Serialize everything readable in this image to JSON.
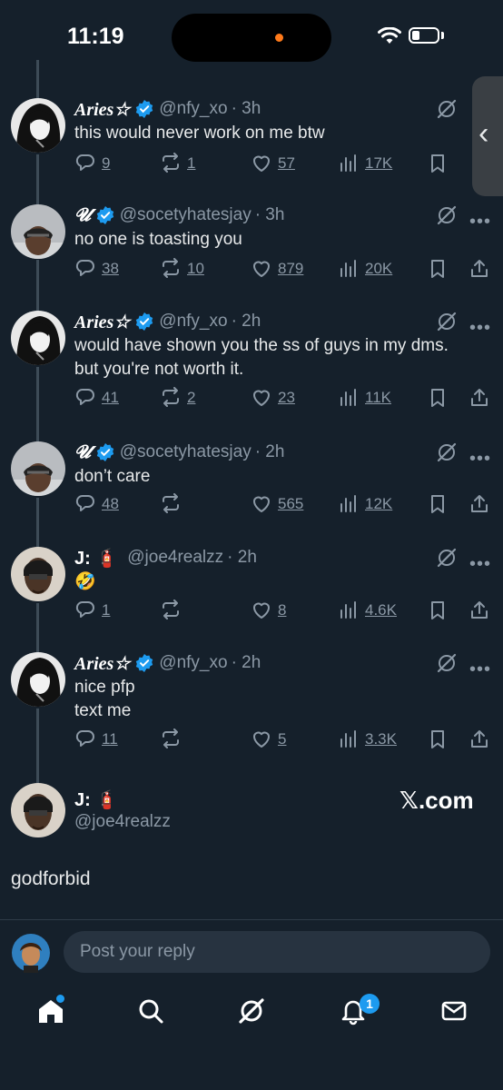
{
  "status_bar": {
    "time": "11:19"
  },
  "tweets": [
    {
      "name": "Aries☆",
      "handle": "@nfy_xo",
      "time": "· 3h",
      "text": [
        "this would never work on me btw"
      ],
      "replies": "9",
      "reposts": "1",
      "likes": "57",
      "views": "17K"
    },
    {
      "name": "𝓤",
      "handle": "@socetyhatesjay",
      "time": "· 3h",
      "text": [
        "no one is toasting you"
      ],
      "replies": "38",
      "reposts": "10",
      "likes": "879",
      "views": "20K"
    },
    {
      "name": "Aries☆",
      "handle": "@nfy_xo",
      "time": "· 2h",
      "text": [
        "would have shown you the ss of guys in my dms.",
        "but you're not worth it."
      ],
      "replies": "41",
      "reposts": "2",
      "likes": "23",
      "views": "11K"
    },
    {
      "name": "𝓤",
      "handle": "@socetyhatesjay",
      "time": "· 2h",
      "text": [
        "don’t care"
      ],
      "replies": "48",
      "reposts": "",
      "likes": "565",
      "views": "12K"
    },
    {
      "name": "J: 🧯",
      "handle": "@joe4realzz",
      "time": "· 2h",
      "text": [
        "🤣"
      ],
      "replies": "1",
      "reposts": "",
      "likes": "8",
      "views": "4.6K"
    },
    {
      "name": "Aries☆",
      "handle": "@nfy_xo",
      "time": "· 2h",
      "text": [
        "nice pfp",
        "text me"
      ],
      "replies": "11",
      "reposts": "",
      "likes": "5",
      "views": "3.3K"
    }
  ],
  "main_post": {
    "name": "J: 🧯",
    "handle": "@joe4realzz",
    "text": "godforbid",
    "watermark": "𝕏.com"
  },
  "reply_bar": {
    "placeholder": "Post your reply"
  },
  "bottom_nav": {
    "notifications_badge": "1"
  },
  "colors": {
    "background": "#15202b",
    "accent": "#1d9bf0",
    "muted": "#8b98a5"
  }
}
